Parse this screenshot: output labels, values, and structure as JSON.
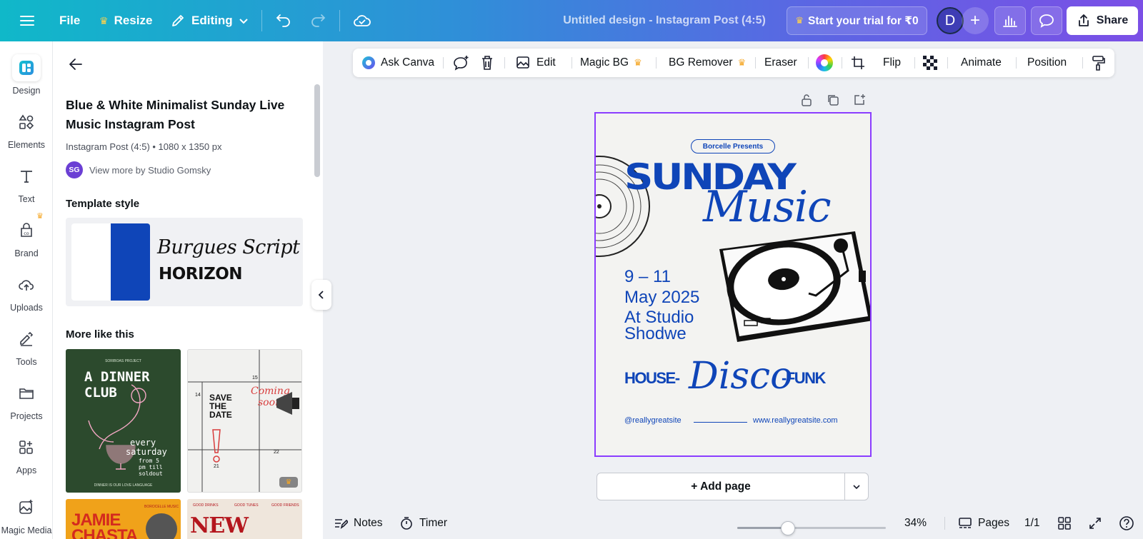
{
  "topbar": {
    "file_label": "File",
    "resize_label": "Resize",
    "editing_label": "Editing",
    "doc_title": "Untitled design - Instagram Post (4:5)",
    "trial_label": "Start your trial for ₹0",
    "avatar_initial": "D",
    "share_label": "Share"
  },
  "rail": {
    "items": [
      {
        "label": "Design",
        "icon": "design-icon"
      },
      {
        "label": "Elements",
        "icon": "elements-icon"
      },
      {
        "label": "Text",
        "icon": "text-icon"
      },
      {
        "label": "Brand",
        "icon": "brand-icon"
      },
      {
        "label": "Uploads",
        "icon": "uploads-icon"
      },
      {
        "label": "Tools",
        "icon": "tools-icon"
      },
      {
        "label": "Projects",
        "icon": "projects-icon"
      },
      {
        "label": "Apps",
        "icon": "apps-icon"
      },
      {
        "label": "Magic Media",
        "icon": "magic-media-icon"
      }
    ]
  },
  "panel": {
    "title": "Blue & White Minimalist Sunday Live Music Instagram Post",
    "meta": "Instagram Post (4:5) • 1080 x 1350 px",
    "author_initials": "SG",
    "author_link": "View more by Studio Gomsky",
    "template_style_heading": "Template style",
    "script_font_sample": "Burgues Script",
    "display_font_sample": "HORIZON",
    "more_like_heading": "More like this",
    "thumbs": [
      {
        "lines": [
          "A DINNER",
          "CLUB",
          "every",
          "saturday",
          "from 5",
          "pm till",
          "soldout"
        ],
        "small_top": "SORIBOAS PROJECT",
        "small_bottom": "DINNER IS OUR LOVE LANGUAGE"
      },
      {
        "lines": [
          "SAVE",
          "THE",
          "DATE",
          "Coming",
          "soon"
        ],
        "numbers": [
          "15",
          "14",
          "22",
          "21"
        ]
      },
      {
        "lines": [
          "JAMIE",
          "CHASTA"
        ],
        "small_top": "BOROCELLE MUSIC"
      },
      {
        "lines": [
          "NEW YEAR'S"
        ],
        "small_top": [
          "GOOD DRINKS",
          "GOOD TUNES",
          "GOOD FRIENDS"
        ]
      }
    ]
  },
  "context_toolbar": {
    "ask_canva": "Ask Canva",
    "edit": "Edit",
    "magic_bg": "Magic BG",
    "bg_remover": "BG Remover",
    "eraser": "Eraser",
    "flip": "Flip",
    "animate": "Animate",
    "position": "Position"
  },
  "poster": {
    "pill": "Borcelle Presents",
    "headline": "SUNDAY",
    "script_word": "Music",
    "dates_line1": "9 – 11",
    "dates_line2": "May 2025",
    "location_line1": "At Studio",
    "location_line2": "Shodwe",
    "genre_left": "HOUSE-",
    "genre_script": "Disco",
    "genre_right": "-FUNK",
    "footer_left": "@reallygreatsite",
    "footer_right": "www.reallygreatsite.com",
    "brand_color": "#0f45b8"
  },
  "canvas": {
    "add_page_label": "+ Add page"
  },
  "bottombar": {
    "notes_label": "Notes",
    "timer_label": "Timer",
    "zoom_percent": 34,
    "zoom_label": "34%",
    "pages_label": "Pages",
    "page_count": "1/1"
  },
  "colors": {
    "accent_purple": "#8b3dff",
    "crown": "#f5a623"
  }
}
